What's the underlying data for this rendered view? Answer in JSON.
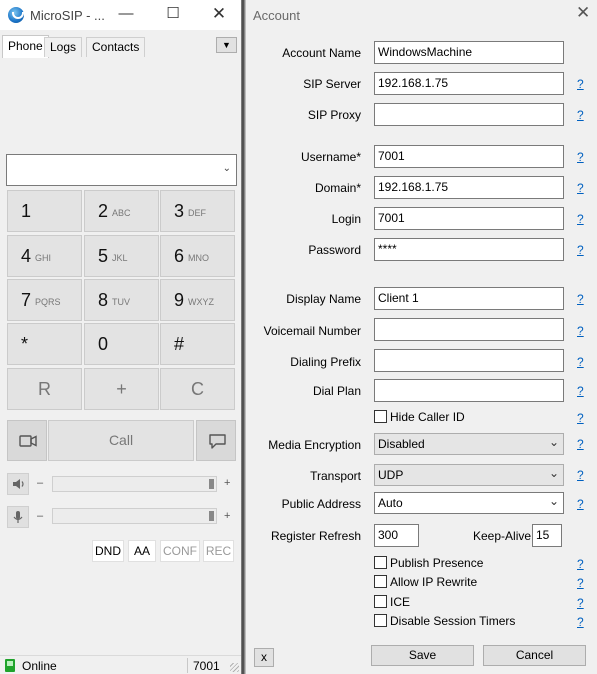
{
  "microsip": {
    "title": "MicroSIP - ...",
    "tabs": [
      "Phone",
      "Logs",
      "Contacts"
    ],
    "dropdown_value": "",
    "keys": [
      {
        "digit": "1",
        "letters": ""
      },
      {
        "digit": "2",
        "letters": "ABC"
      },
      {
        "digit": "3",
        "letters": "DEF"
      },
      {
        "digit": "4",
        "letters": "GHI"
      },
      {
        "digit": "5",
        "letters": "JKL"
      },
      {
        "digit": "6",
        "letters": "MNO"
      },
      {
        "digit": "7",
        "letters": "PQRS"
      },
      {
        "digit": "8",
        "letters": "TUV"
      },
      {
        "digit": "9",
        "letters": "WXYZ"
      },
      {
        "digit": "*",
        "letters": ""
      },
      {
        "digit": "0",
        "letters": ""
      },
      {
        "digit": "#",
        "letters": ""
      }
    ],
    "actions": {
      "redial": "R",
      "plus": "+",
      "clear": "C"
    },
    "call_label": "Call",
    "minus_sign": "–",
    "plus_sign": "+",
    "features": [
      "DND",
      "AA",
      "CONF",
      "REC"
    ],
    "status": {
      "text": "Online",
      "extension": "7001"
    }
  },
  "account": {
    "title": "Account",
    "fields": {
      "account_name": {
        "label": "Account Name",
        "value": "WindowsMachine"
      },
      "sip_server": {
        "label": "SIP Server",
        "value": "192.168.1.75"
      },
      "sip_proxy": {
        "label": "SIP Proxy",
        "value": ""
      },
      "username": {
        "label": "Username*",
        "value": "7001"
      },
      "domain": {
        "label": "Domain*",
        "value": "192.168.1.75"
      },
      "login": {
        "label": "Login",
        "value": "7001"
      },
      "password": {
        "label": "Password",
        "value": "****"
      },
      "display_name": {
        "label": "Display Name",
        "value": "Client 1"
      },
      "voicemail_number": {
        "label": "Voicemail Number",
        "value": ""
      },
      "dialing_prefix": {
        "label": "Dialing Prefix",
        "value": ""
      },
      "dial_plan": {
        "label": "Dial Plan",
        "value": ""
      },
      "media_encryption": {
        "label": "Media Encryption",
        "value": "Disabled"
      },
      "transport": {
        "label": "Transport",
        "value": "UDP"
      },
      "public_address": {
        "label": "Public Address",
        "value": "Auto"
      },
      "register_refresh": {
        "label": "Register Refresh",
        "value": "300"
      },
      "keep_alive": {
        "label": "Keep-Alive",
        "value": "15"
      }
    },
    "checkboxes": {
      "hide_caller_id": {
        "label": "Hide Caller ID",
        "checked": false
      },
      "publish_presence": {
        "label": "Publish Presence",
        "checked": false
      },
      "allow_ip_rewrite": {
        "label": "Allow IP Rewrite",
        "checked": false
      },
      "ice": {
        "label": "ICE",
        "checked": false
      },
      "disable_session_timers": {
        "label": "Disable Session Timers",
        "checked": false
      }
    },
    "help_mark": "?",
    "buttons": {
      "remove": "x",
      "save": "Save",
      "cancel": "Cancel"
    }
  }
}
